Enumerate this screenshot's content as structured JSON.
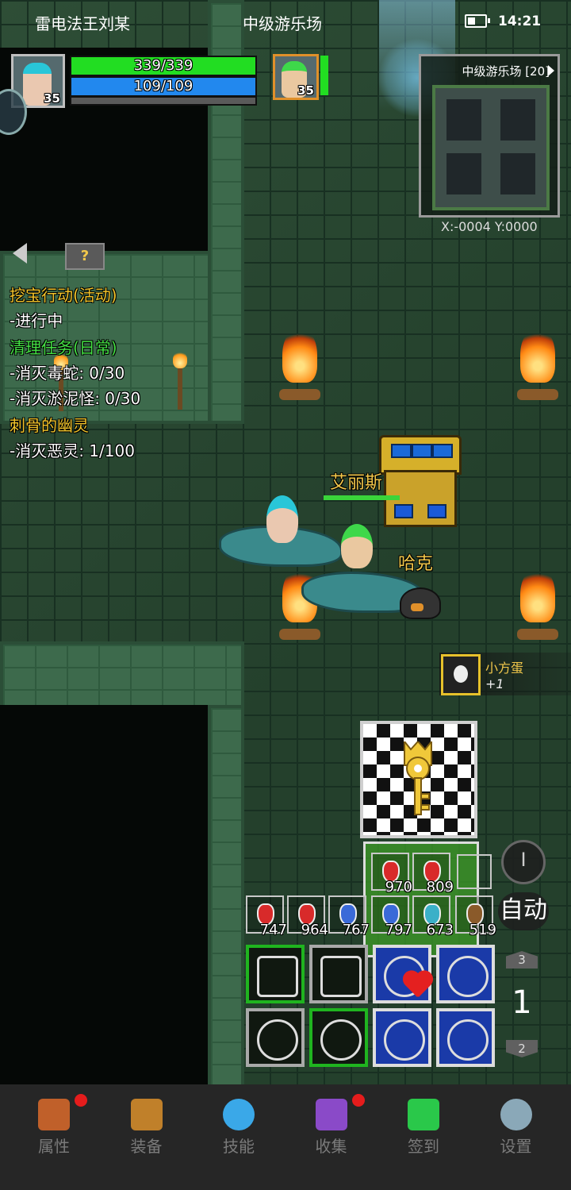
{
  "status_bar": {
    "player_name": "雷电法王刘某",
    "map_name": "中级游乐场",
    "time": "14:21"
  },
  "player": {
    "level": "35",
    "hp": "339/339",
    "mp": "109/109",
    "hp_ratio": 1.0,
    "mp_ratio": 1.0
  },
  "pet": {
    "level": "35",
    "hp_ratio": 1.0
  },
  "minimap": {
    "title": "中级游乐场 [20]",
    "coords": "X:-0004  Y:0000"
  },
  "quests": [
    {
      "text": "挖宝行动(活动)",
      "style": "title"
    },
    {
      "text": "-进行中",
      "style": "normal"
    },
    {
      "text": "清理任务(日常)",
      "style": "green"
    },
    {
      "text": "-消灭毒蛇: 0/30",
      "style": "normal"
    },
    {
      "text": "-消灭淤泥怪: 0/30",
      "style": "normal"
    },
    {
      "text": "刺骨的幽灵",
      "style": "title"
    },
    {
      "text": "-消灭恶灵: 1/100",
      "style": "normal"
    }
  ],
  "quest_help_label": "?",
  "npcs": {
    "ellis": "艾丽斯",
    "hack": "哈克",
    "ellis_hp_ratio": 1.0
  },
  "loot_notice": {
    "item": "小方蛋",
    "qty": "+1"
  },
  "potions_row": [
    {
      "count": "747",
      "color": "#d82a2a"
    },
    {
      "count": "964",
      "color": "#d82a2a"
    },
    {
      "count": "767",
      "color": "#3a6ad8"
    },
    {
      "count": "797",
      "color": "#3a6ad8"
    },
    {
      "count": "673",
      "color": "#3ab0c8"
    },
    {
      "count": "519",
      "color": "#8a5a2a"
    }
  ],
  "potions_upper": [
    {
      "count": "970",
      "color": "#d82a2a"
    },
    {
      "count": "809",
      "color": "#d82a2a"
    }
  ],
  "controls": {
    "toggle_label": "I",
    "auto_label": "自动",
    "page_up": "3",
    "page_current": "1",
    "page_down": "2"
  },
  "nav": [
    {
      "label": "属性",
      "icon": "helmet-icon",
      "badge": true,
      "color": "#c0602a"
    },
    {
      "label": "装备",
      "icon": "bag-icon",
      "badge": false,
      "color": "#c0802a"
    },
    {
      "label": "技能",
      "icon": "skill-orb-icon",
      "badge": false,
      "color": "#3aa8e8"
    },
    {
      "label": "收集",
      "icon": "collection-book-icon",
      "badge": true,
      "color": "#8a4ac8"
    },
    {
      "label": "签到",
      "icon": "gem-icon",
      "badge": false,
      "color": "#2ac84a"
    },
    {
      "label": "设置",
      "icon": "gear-icon",
      "badge": false,
      "color": "#8aa8b8"
    }
  ],
  "colors": {
    "hp": "#22dd22",
    "mp": "#2288ee",
    "quest_title": "#f3c52b",
    "quest_green": "#44e044",
    "badge": "#e51c1c"
  }
}
